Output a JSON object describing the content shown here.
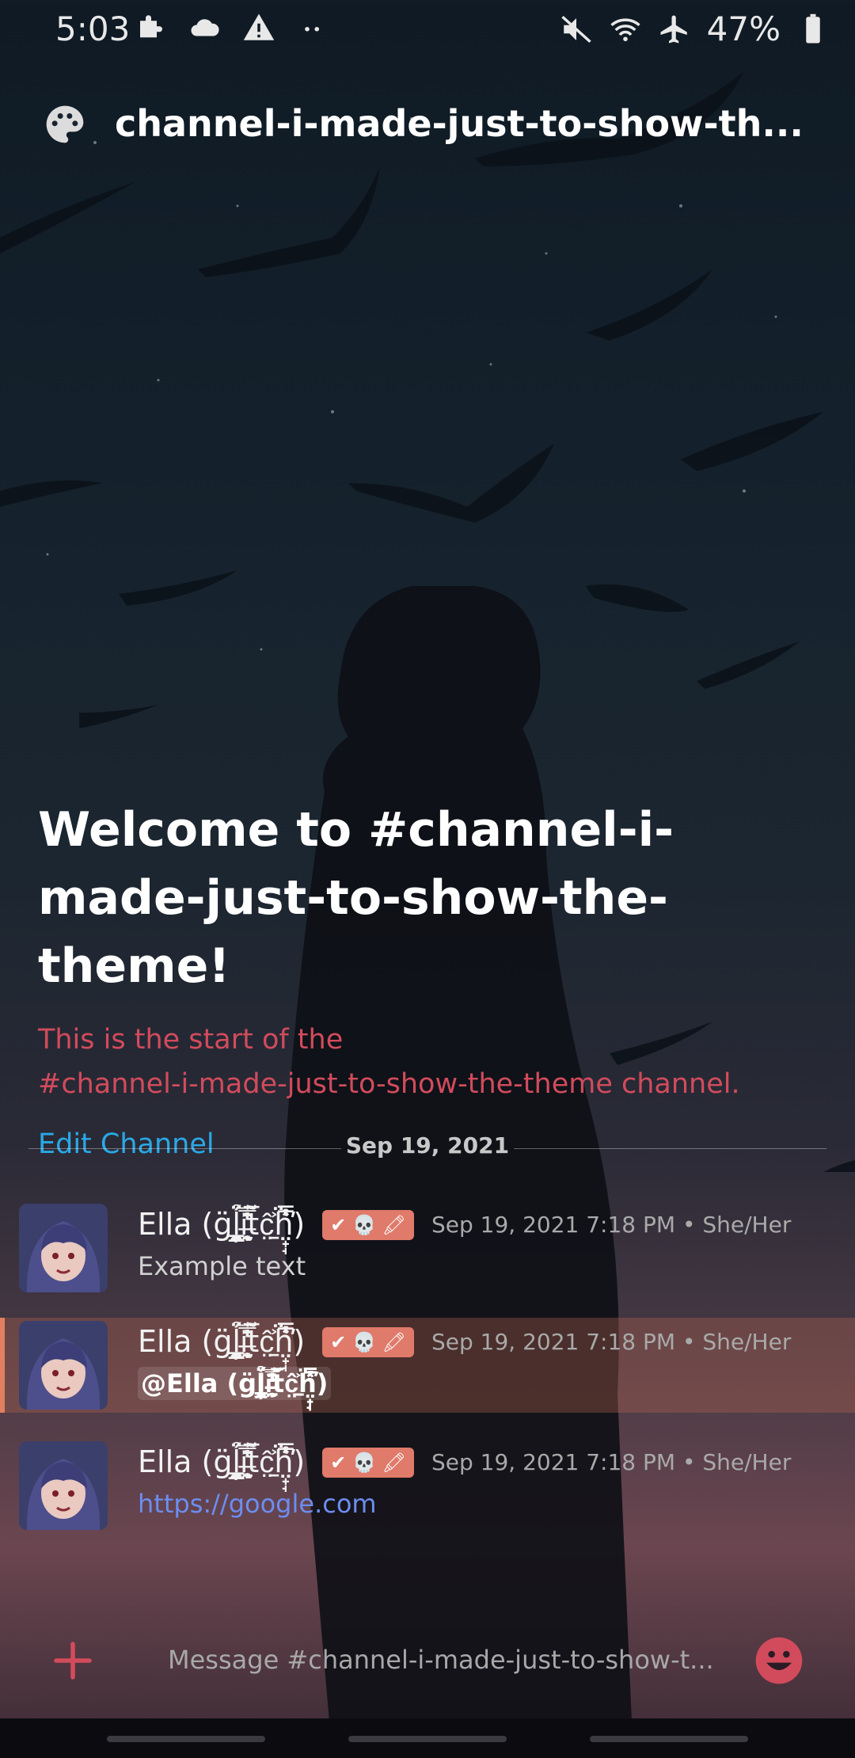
{
  "status_bar": {
    "time": "5:03",
    "battery": "47%",
    "icons_left": [
      "puzzle-icon",
      "cloud-icon",
      "warning-icon",
      "more-dots-icon"
    ],
    "icons_right": [
      "mute-icon",
      "wifi-icon",
      "airplane-icon",
      "battery-icon"
    ]
  },
  "header": {
    "icon": "palette-icon",
    "channel_name": "channel-i-made-just-to-show-th..."
  },
  "welcome": {
    "title": "Welcome to #channel-i-made-just-to-show-the-theme!",
    "subtitle_line1": "This is the start of the",
    "subtitle_line2": "#channel-i-made-just-to-show-the-theme channel.",
    "edit_link": "Edit Channel"
  },
  "divider": {
    "date": "Sep 19, 2021"
  },
  "messages": [
    {
      "author": "Ella (g̈l̗̙̰̳̺̻̼̜̉̈́i̶͙̞̠̩̰̿̓̂̒̄t̃͂̅̆̇ĉ̤̠͐ḧ̤̟̘̍̔̽̿̕)",
      "badge": "✔ 💀 🖍",
      "timestamp": "Sep 19, 2021 7:18 PM • She/Her",
      "body": "Example text"
    },
    {
      "author": "Ella (g̈l̗̙̰̳̺̻̼̜̉̈́i̶͙̞̠̩̰̿̓̂̒̄t̃͂̅̆̇ĉ̤̠͐ḧ̤̟̘̍̔̽̿̕)",
      "badge": "✔ 💀 🖍",
      "timestamp": "Sep 19, 2021 7:18 PM • She/Her",
      "body": "@Ella (g̈l̗̙̰̳̺̻̼̜̉̈́i̶͙̞̠̩̰̿̓̂̒̄t̃͂̅̆̇ĉ̤̠͐ḧ̤̟̘̍̔̽̿̕)"
    },
    {
      "author": "Ella (g̈l̗̙̰̳̺̻̼̜̉̈́i̶͙̞̠̩̰̿̓̂̒̄t̃͂̅̆̇ĉ̤̠͐ḧ̤̟̘̍̔̽̿̕)",
      "badge": "✔ 💀 🖍",
      "timestamp": "Sep 19, 2021 7:18 PM • She/Her",
      "body": "https://google.com"
    }
  ],
  "input": {
    "placeholder": "Message #channel-i-made-just-to-show-t..."
  },
  "colors": {
    "accent_red": "#d24b5c",
    "link_blue": "#2aa8e6",
    "url_blue": "#6d8df0",
    "badge_bg": "#e07a6a"
  }
}
